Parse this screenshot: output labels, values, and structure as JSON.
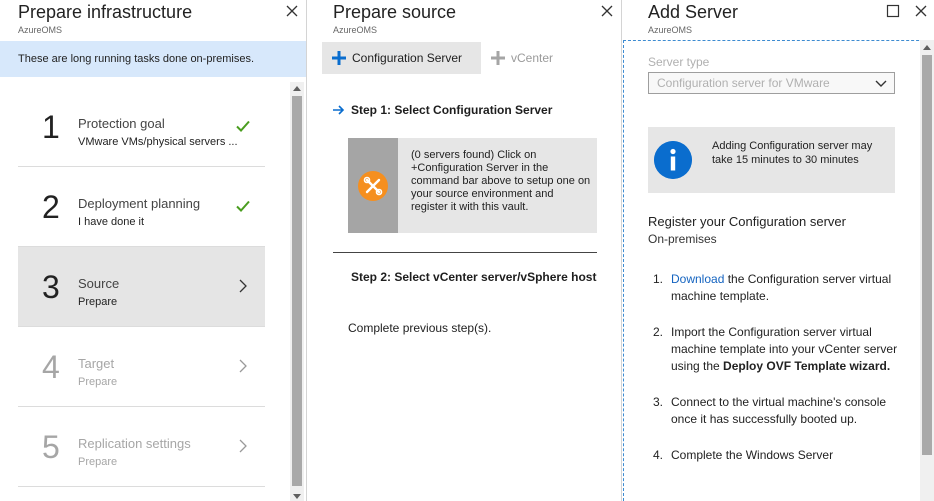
{
  "blade1": {
    "title": "Prepare infrastructure",
    "subtitle": "AzureOMS",
    "banner": "These are long running tasks done on-premises.",
    "steps": [
      {
        "num": "1",
        "title": "Protection goal",
        "sub": "VMware VMs/physical servers ...",
        "state": "done"
      },
      {
        "num": "2",
        "title": "Deployment planning",
        "sub": "I have done it",
        "state": "done"
      },
      {
        "num": "3",
        "title": "Source",
        "sub": "Prepare",
        "state": "active"
      },
      {
        "num": "4",
        "title": "Target",
        "sub": "Prepare",
        "state": "disabled"
      },
      {
        "num": "5",
        "title": "Replication settings",
        "sub": "Prepare",
        "state": "disabled"
      }
    ]
  },
  "blade2": {
    "title": "Prepare source",
    "subtitle": "AzureOMS",
    "cmd_config": "Configuration Server",
    "cmd_vcenter": "vCenter",
    "step1_head": "Step 1: Select Configuration Server",
    "step1_info": "(0 servers found) Click on +Configuration Server in the command bar above to setup one on your source environment and register it with this vault.",
    "step2_head": "Step 2: Select vCenter server/vSphere host",
    "step2_note": "Complete previous step(s)."
  },
  "blade3": {
    "title": "Add Server",
    "subtitle": "AzureOMS",
    "server_type_label": "Server type",
    "server_type_value": "Configuration server for VMware",
    "note": "Adding Configuration server may take 15 minutes to 30 minutes",
    "register_title": "Register your Configuration server",
    "register_sub": "On-premises",
    "list": {
      "n1": "1.",
      "link1": "Download",
      "item1_rest": " the Configuration server virtual machine template.",
      "n2": "2.",
      "item2_a": "Import the Configuration server virtual machine template into your vCenter server using the ",
      "item2_bold": "Deploy OVF Template wizard.",
      "n3": "3.",
      "item3": "Connect to the virtual machine's console once it has successfully booted up.",
      "n4": "4.",
      "item4": "Complete the Windows Server"
    }
  },
  "colors": {
    "accent": "#0a6dce",
    "check": "#4a9d1f",
    "tool_orange": "#f58f1f",
    "banner": "#d7e8fb"
  }
}
